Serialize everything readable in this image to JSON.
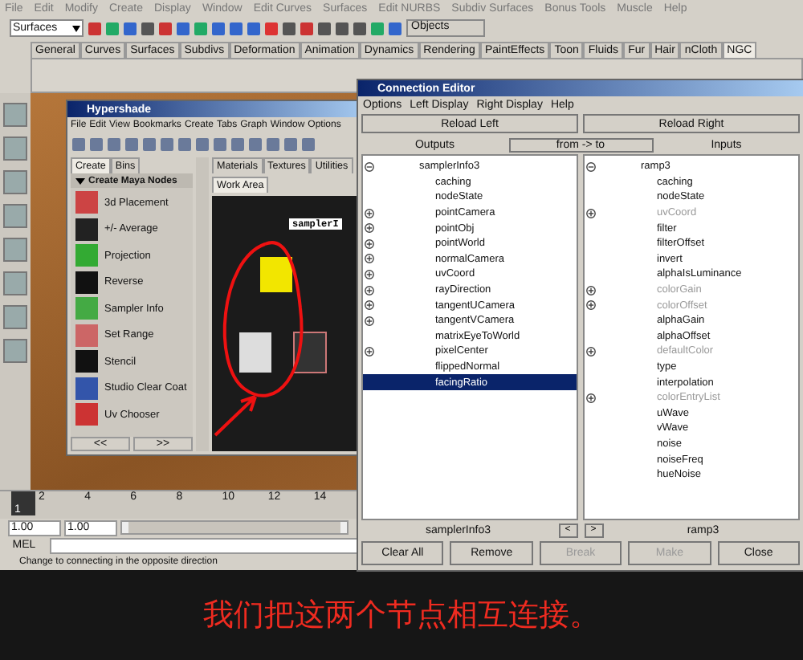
{
  "main_menu": [
    "File",
    "Edit",
    "Modify",
    "Create",
    "Display",
    "Window",
    "Edit Curves",
    "Surfaces",
    "Edit NURBS",
    "Subdiv Surfaces",
    "Bonus Tools",
    "Muscle",
    "Help"
  ],
  "menu_set": "Surfaces",
  "selection_field": "Objects",
  "shelf_tabs": [
    {
      "label": "General",
      "selected": false
    },
    {
      "label": "Curves",
      "selected": false
    },
    {
      "label": "Surfaces",
      "selected": false
    },
    {
      "label": "Subdivs",
      "selected": false
    },
    {
      "label": "Deformation",
      "selected": false
    },
    {
      "label": "Animation",
      "selected": false
    },
    {
      "label": "Dynamics",
      "selected": false
    },
    {
      "label": "Rendering",
      "selected": false
    },
    {
      "label": "PaintEffects",
      "selected": false
    },
    {
      "label": "Toon",
      "selected": false
    },
    {
      "label": "Fluids",
      "selected": false
    },
    {
      "label": "Fur",
      "selected": false
    },
    {
      "label": "Hair",
      "selected": false
    },
    {
      "label": "nCloth",
      "selected": false
    },
    {
      "label": "NGC",
      "selected": true
    }
  ],
  "hypershade": {
    "title": "Hypershade",
    "menu": [
      "File",
      "Edit",
      "View",
      "Bookmarks",
      "Create",
      "Tabs",
      "Graph",
      "Window",
      "Options"
    ],
    "create_tabs": [
      {
        "label": "Create",
        "selected": true
      },
      {
        "label": "Bins",
        "selected": false
      }
    ],
    "section": "Create Maya Nodes",
    "section_expanded": true,
    "nodes": [
      "3d Placement",
      "+/- Average",
      "Projection",
      "Reverse",
      "Sampler Info",
      "Set Range",
      "Stencil",
      "Studio Clear Coat",
      "Uv Chooser"
    ],
    "nav": [
      "<<",
      ">>"
    ],
    "shader_tabs": [
      "Materials",
      "Textures",
      "Utilities"
    ],
    "work_tab": "Work Area",
    "node_label": "samplerI"
  },
  "connection_editor": {
    "title": "Connection Editor",
    "menu": [
      "Options",
      "Left Display",
      "Right Display",
      "Help"
    ],
    "reload": [
      "Reload Left",
      "Reload Right"
    ],
    "outputs": "Outputs",
    "direction": "from -> to",
    "inputs": "Inputs",
    "left": {
      "name": "samplerInfo3",
      "expanded": true,
      "attributes": [
        {
          "name": "caching",
          "expandable": false,
          "selected": false
        },
        {
          "name": "nodeState",
          "expandable": false,
          "selected": false
        },
        {
          "name": "pointCamera",
          "expandable": true,
          "selected": false
        },
        {
          "name": "pointObj",
          "expandable": true,
          "selected": false
        },
        {
          "name": "pointWorld",
          "expandable": true,
          "selected": false
        },
        {
          "name": "normalCamera",
          "expandable": true,
          "selected": false
        },
        {
          "name": "uvCoord",
          "expandable": true,
          "selected": false
        },
        {
          "name": "rayDirection",
          "expandable": true,
          "selected": false
        },
        {
          "name": "tangentUCamera",
          "expandable": true,
          "selected": false
        },
        {
          "name": "tangentVCamera",
          "expandable": true,
          "selected": false
        },
        {
          "name": "matrixEyeToWorld",
          "expandable": false,
          "selected": false
        },
        {
          "name": "pixelCenter",
          "expandable": true,
          "selected": false
        },
        {
          "name": "flippedNormal",
          "expandable": false,
          "selected": false
        },
        {
          "name": "facingRatio",
          "expandable": false,
          "selected": true
        }
      ]
    },
    "right": {
      "name": "ramp3",
      "expanded": true,
      "attributes": [
        {
          "name": "caching",
          "expandable": false,
          "disabled": false
        },
        {
          "name": "nodeState",
          "expandable": false,
          "disabled": false
        },
        {
          "name": "uvCoord",
          "expandable": true,
          "disabled": true
        },
        {
          "name": "filter",
          "expandable": false,
          "disabled": false
        },
        {
          "name": "filterOffset",
          "expandable": false,
          "disabled": false
        },
        {
          "name": "invert",
          "expandable": false,
          "disabled": false
        },
        {
          "name": "alphaIsLuminance",
          "expandable": false,
          "disabled": false
        },
        {
          "name": "colorGain",
          "expandable": true,
          "disabled": true
        },
        {
          "name": "colorOffset",
          "expandable": true,
          "disabled": true
        },
        {
          "name": "alphaGain",
          "expandable": false,
          "disabled": false
        },
        {
          "name": "alphaOffset",
          "expandable": false,
          "disabled": false
        },
        {
          "name": "defaultColor",
          "expandable": true,
          "disabled": true
        },
        {
          "name": "type",
          "expandable": false,
          "disabled": false
        },
        {
          "name": "interpolation",
          "expandable": false,
          "disabled": false
        },
        {
          "name": "colorEntryList",
          "expandable": true,
          "disabled": true
        },
        {
          "name": "uWave",
          "expandable": false,
          "disabled": false
        },
        {
          "name": "vWave",
          "expandable": false,
          "disabled": false
        },
        {
          "name": "noise",
          "expandable": false,
          "disabled": false
        },
        {
          "name": "noiseFreq",
          "expandable": false,
          "disabled": false
        },
        {
          "name": "hueNoise",
          "expandable": false,
          "disabled": false
        }
      ]
    },
    "footer": {
      "left": "samplerInfo3",
      "prev": "<",
      "next": ">",
      "right": "ramp3"
    },
    "buttons": [
      {
        "label": "Clear All",
        "disabled": false
      },
      {
        "label": "Remove",
        "disabled": false
      },
      {
        "label": "Break",
        "disabled": true
      },
      {
        "label": "Make",
        "disabled": true
      },
      {
        "label": "Close",
        "disabled": false
      }
    ]
  },
  "timeline": {
    "ticks": [
      "2",
      "4",
      "6",
      "8",
      "10",
      "12",
      "14"
    ],
    "current": "1"
  },
  "range": {
    "start": "1.00",
    "end": "1.00",
    "level": 1
  },
  "mel_label": "MEL",
  "status": "Change to connecting in the opposite direction",
  "caption": "我们把这两个节点相互连接。"
}
